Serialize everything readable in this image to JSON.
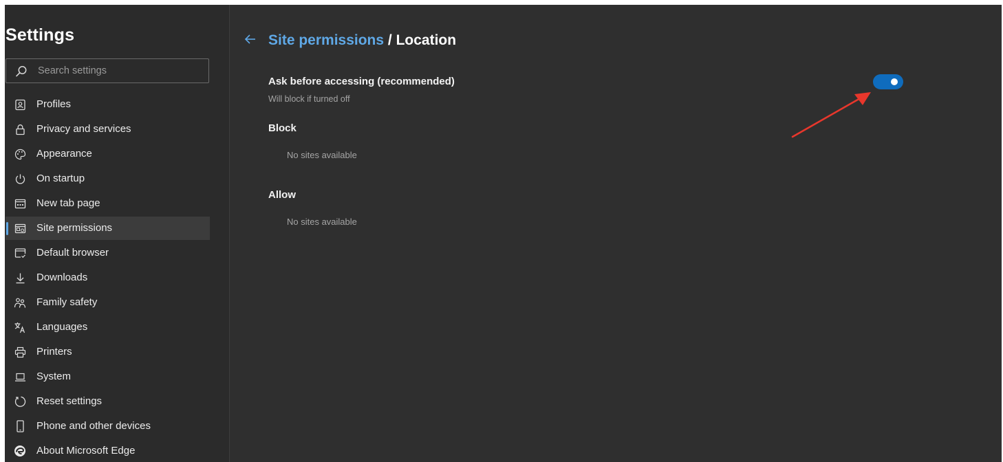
{
  "sidebar": {
    "title": "Settings",
    "search_placeholder": "Search settings",
    "items": [
      {
        "label": "Profiles",
        "icon": "profile-icon"
      },
      {
        "label": "Privacy and services",
        "icon": "lock-icon"
      },
      {
        "label": "Appearance",
        "icon": "palette-icon"
      },
      {
        "label": "On startup",
        "icon": "power-icon"
      },
      {
        "label": "New tab page",
        "icon": "new-tab-icon"
      },
      {
        "label": "Site permissions",
        "icon": "site-permissions-icon",
        "active": true
      },
      {
        "label": "Default browser",
        "icon": "default-browser-icon"
      },
      {
        "label": "Downloads",
        "icon": "download-icon"
      },
      {
        "label": "Family safety",
        "icon": "family-icon"
      },
      {
        "label": "Languages",
        "icon": "languages-icon"
      },
      {
        "label": "Printers",
        "icon": "printer-icon"
      },
      {
        "label": "System",
        "icon": "laptop-icon"
      },
      {
        "label": "Reset settings",
        "icon": "reset-icon"
      },
      {
        "label": "Phone and other devices",
        "icon": "phone-icon"
      },
      {
        "label": "About Microsoft Edge",
        "icon": "edge-logo-icon"
      }
    ]
  },
  "main": {
    "breadcrumb": {
      "parent": "Site permissions",
      "separator": " / ",
      "current": "Location"
    },
    "ask_setting": {
      "label": "Ask before accessing (recommended)",
      "description": "Will block if turned off",
      "enabled": true
    },
    "block": {
      "title": "Block",
      "empty_text": "No sites available"
    },
    "allow": {
      "title": "Allow",
      "empty_text": "No sites available"
    }
  },
  "colors": {
    "background": "#2f2f2f",
    "sidebar_background": "#2b2b2b",
    "accent": "#5fa8e6",
    "toggle_on": "#0f6cbd",
    "annotation_arrow": "#e8372c"
  }
}
